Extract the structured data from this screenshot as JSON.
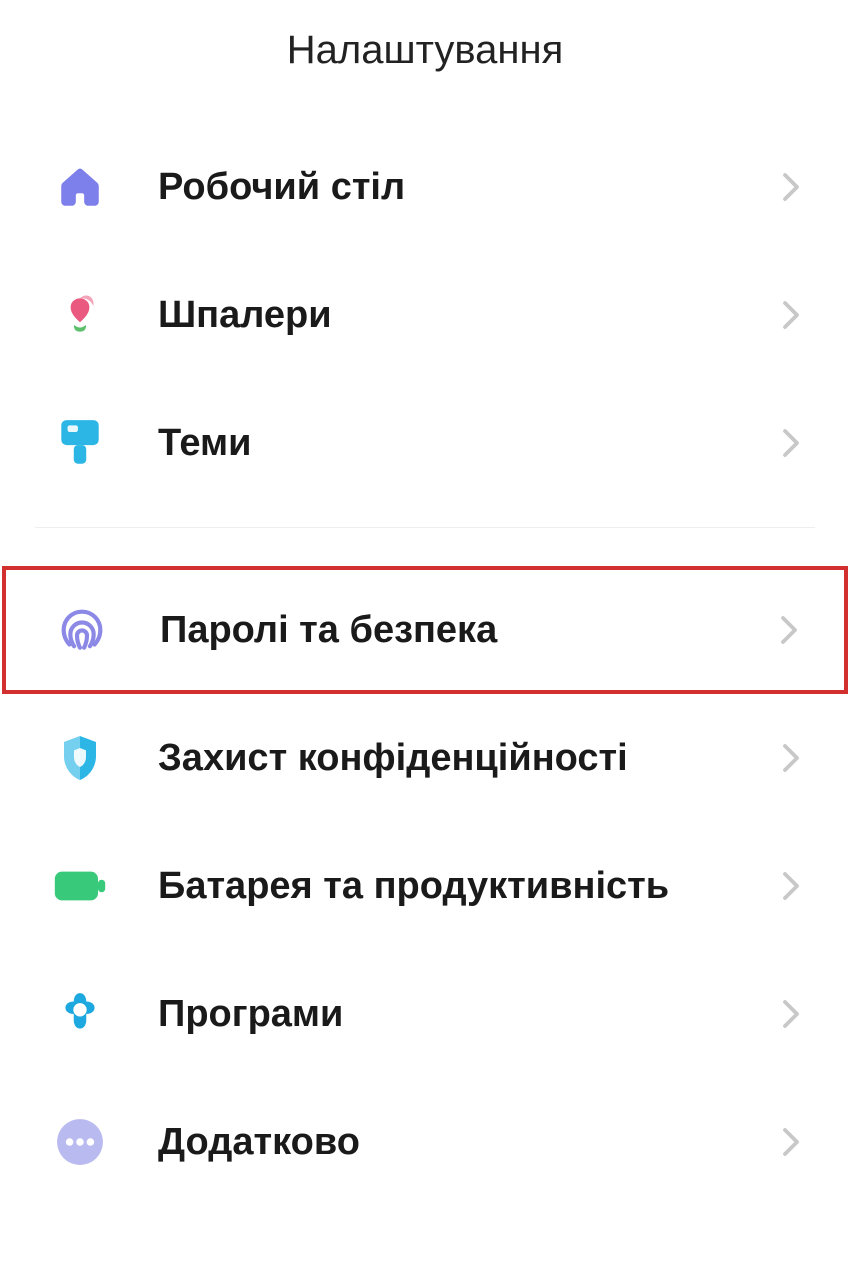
{
  "header": {
    "title": "Налаштування"
  },
  "groups": [
    {
      "items": [
        {
          "icon": "home-icon",
          "label": "Робочий стіл",
          "highlighted": false
        },
        {
          "icon": "wallpaper-icon",
          "label": "Шпалери",
          "highlighted": false
        },
        {
          "icon": "themes-icon",
          "label": "Теми",
          "highlighted": false
        }
      ]
    },
    {
      "items": [
        {
          "icon": "fingerprint-icon",
          "label": "Паролі та безпека",
          "highlighted": true
        },
        {
          "icon": "shield-icon",
          "label": "Захист конфіденційності",
          "highlighted": false
        },
        {
          "icon": "battery-icon",
          "label": "Батарея та продуктивність",
          "highlighted": false
        },
        {
          "icon": "apps-icon",
          "label": "Програми",
          "highlighted": false
        },
        {
          "icon": "more-icon",
          "label": "Додатково",
          "highlighted": false
        }
      ]
    }
  ]
}
